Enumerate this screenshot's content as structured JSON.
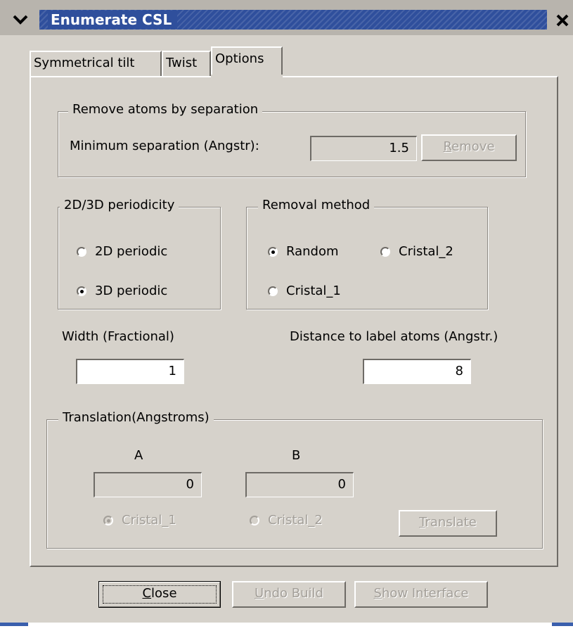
{
  "window": {
    "title": "Enumerate CSL"
  },
  "tabs": [
    {
      "label": "Symmetrical tilt",
      "active": false
    },
    {
      "label": "Twist",
      "active": false
    },
    {
      "label": "Options",
      "active": true
    }
  ],
  "remove_atoms": {
    "group_title": "Remove atoms by separation",
    "min_sep_label": "Minimum separation (Angstr):",
    "min_sep_value": "1.5",
    "remove_button": {
      "mnemonic": "R",
      "rest": "emove",
      "enabled": false
    }
  },
  "periodicity": {
    "group_title": "2D/3D periodicity",
    "options": [
      {
        "label": "2D periodic",
        "checked": false
      },
      {
        "label": "3D periodic",
        "checked": true
      }
    ]
  },
  "removal_method": {
    "group_title": "Removal method",
    "options": [
      {
        "label": "Random",
        "checked": true
      },
      {
        "label": "Cristal_2",
        "checked": false
      },
      {
        "label": "Cristal_1",
        "checked": false
      }
    ]
  },
  "width": {
    "label": "Width (Fractional)",
    "value": "1"
  },
  "distance": {
    "label": "Distance to label atoms (Angstr.)",
    "value": "8"
  },
  "translation": {
    "group_title": "Translation(Angstroms)",
    "a_label": "A",
    "a_value": "0",
    "b_label": "B",
    "b_value": "0",
    "options": [
      {
        "label": "Cristal_1",
        "checked": true,
        "enabled": false
      },
      {
        "label": "Cristal_2",
        "checked": false,
        "enabled": false
      }
    ],
    "translate_button": {
      "mnemonic": "T",
      "rest": "ranslate",
      "enabled": false
    }
  },
  "footer": {
    "close_button": {
      "mnemonic": "C",
      "rest": "lose",
      "enabled": true
    },
    "undo_button": {
      "mnemonic": "U",
      "rest": "ndo Build",
      "enabled": false
    },
    "show_button": {
      "mnemonic": "S",
      "rest": "how Interface",
      "enabled": false
    }
  },
  "colors": {
    "window_bg": "#d6d2cb",
    "titlebar_accent": "#2f4f9c",
    "disabled_text": "#a39f99"
  }
}
